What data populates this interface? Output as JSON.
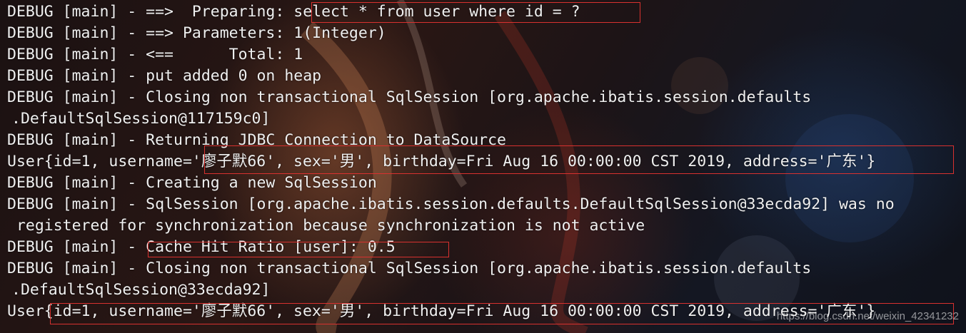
{
  "console": {
    "lines": [
      "DEBUG [main] - ==>  Preparing: select * from user where id = ?",
      "DEBUG [main] - ==> Parameters: 1(Integer)",
      "DEBUG [main] - <==      Total: 1",
      "DEBUG [main] - put added 0 on heap",
      "DEBUG [main] - Closing non transactional SqlSession [org.apache.ibatis.session.defaults",
      ".DefaultSqlSession@117159c0]",
      "DEBUG [main] - Returning JDBC Connection to DataSource",
      "User{id=1, username='廖子默66', sex='男', birthday=Fri Aug 16 00:00:00 CST 2019, address='广东'}",
      "DEBUG [main] - Creating a new SqlSession",
      "DEBUG [main] - SqlSession [org.apache.ibatis.session.defaults.DefaultSqlSession@33ecda92] was no",
      " registered for synchronization because synchronization is not active",
      "DEBUG [main] - Cache Hit Ratio [user]: 0.5",
      "DEBUG [main] - Closing non transactional SqlSession [org.apache.ibatis.session.defaults",
      ".DefaultSqlSession@33ecda92]",
      "User{id=1, username='廖子默66', sex='男', birthday=Fri Aug 16 00:00:00 CST 2019, address='广东'}"
    ]
  },
  "highlight_color": "#d8312f",
  "watermark": "https://blog.csdn.net/weixin_42341232"
}
